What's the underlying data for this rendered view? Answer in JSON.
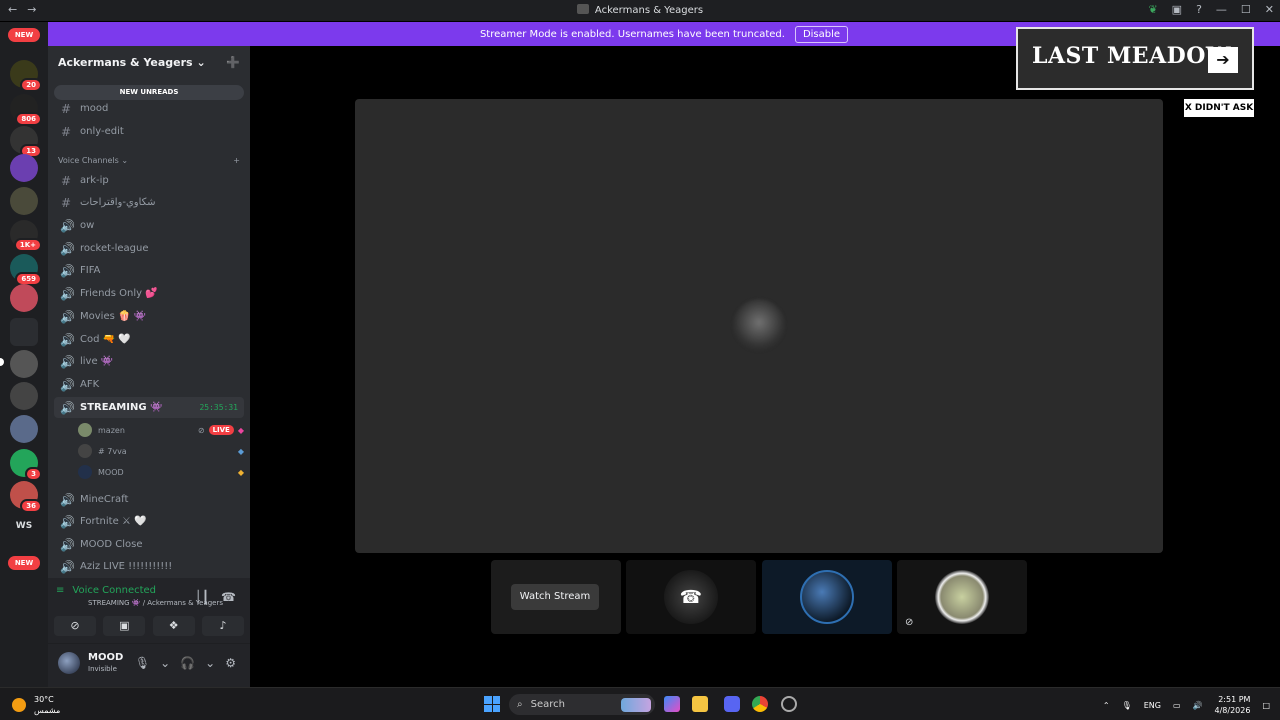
{
  "window": {
    "title": "Ackermans & Yeagers",
    "nav_back": "←",
    "nav_forward": "→",
    "controls": [
      "✓",
      "🖥",
      "?",
      "—",
      "☐",
      "✕"
    ]
  },
  "banner": {
    "text": "Streamer Mode is enabled. Usernames have been truncated.",
    "button": "Disable"
  },
  "rail": {
    "new_top": "NEW",
    "new_bottom": "NEW",
    "ws_label": "WS",
    "badges": [
      "20",
      "806",
      "13",
      "1K+",
      "659",
      "3",
      "36"
    ]
  },
  "server": {
    "name": "Ackermans & Yeagers",
    "new_unreads": "NEW UNREADS",
    "channels_top": [
      {
        "name": "mood",
        "icon": "#"
      },
      {
        "name": "only-edit",
        "icon": "#"
      }
    ],
    "category": "Voice Channels",
    "channels": [
      {
        "name": "ark-ip",
        "icon": "#"
      },
      {
        "name": "شكاوي-واقتراحات",
        "icon": "#"
      },
      {
        "name": "ow",
        "icon": "🔊"
      },
      {
        "name": "rocket-league",
        "icon": "🔊"
      },
      {
        "name": "FIFA",
        "icon": "🔊"
      },
      {
        "name": "Friends Only 💕",
        "icon": "🔊"
      },
      {
        "name": "Movies 🍿 👾",
        "icon": "🔊"
      },
      {
        "name": "Cod 🔫 🤍",
        "icon": "🔊"
      },
      {
        "name": "live 👾",
        "icon": "🔊"
      },
      {
        "name": "AFK",
        "icon": "🔊"
      }
    ],
    "active_channel": {
      "name": "STREAMING 👾",
      "timer": "25:35:31"
    },
    "voice_users": [
      {
        "name": "mazen",
        "live": "LIVE"
      },
      {
        "name": "# 7vva",
        "live": ""
      },
      {
        "name": "MOOD",
        "live": ""
      }
    ],
    "channels_after": [
      {
        "name": "MineCraft",
        "icon": "🔊"
      },
      {
        "name": "Fortnite ⚔ 🤍",
        "icon": "🔊"
      },
      {
        "name": "MOOD Close",
        "icon": "🔊"
      },
      {
        "name": "Aziz LIVE !!!!!!!!!!!",
        "icon": "🔊"
      }
    ]
  },
  "voice_panel": {
    "status": "Voice Connected",
    "location": "STREAMING 👾 / Ackermans & Yeagers"
  },
  "user_panel": {
    "name": "MOOD",
    "status": "Invisible"
  },
  "stage": {
    "watch_stream": "Watch Stream"
  },
  "ad": {
    "text": "LAST MEADOW",
    "arrow": "➔",
    "close": "X DIDN'T ASK"
  },
  "taskbar": {
    "temp": "30°C",
    "weather": "مشمس",
    "search": "Search",
    "lang": "ENG",
    "time": "2:51 PM",
    "date": "4/8/2026"
  }
}
